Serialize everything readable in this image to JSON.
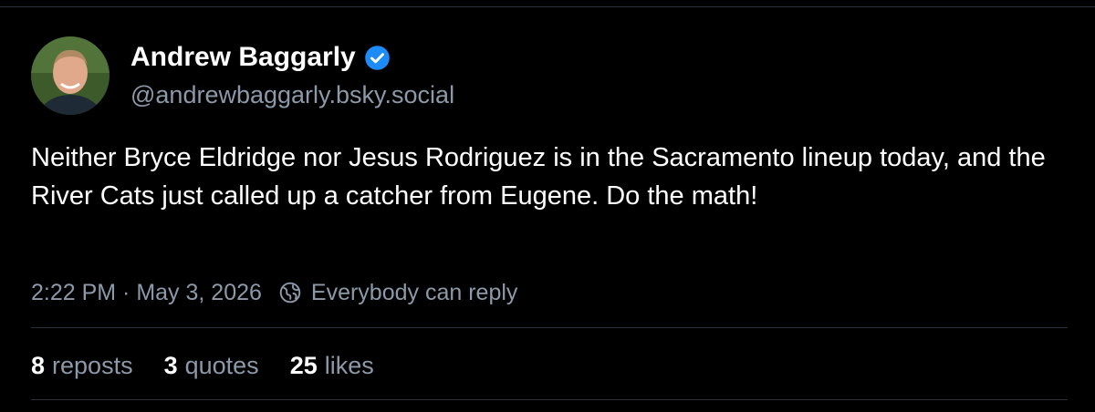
{
  "author": {
    "display_name": "Andrew Baggarly",
    "handle": "@andrewbaggarly.bsky.social",
    "verified": true
  },
  "post": {
    "text": "Neither Bryce Eldridge nor Jesus Rodriguez is in the Sacramento lineup today, and the River Cats just called up a catcher from Eugene. Do the math!",
    "timestamp": "2:22 PM · May 3, 2026",
    "reply_setting": "Everybody can reply"
  },
  "stats": {
    "reposts_count": "8",
    "reposts_label": "reposts",
    "quotes_count": "3",
    "quotes_label": "quotes",
    "likes_count": "25",
    "likes_label": "likes"
  },
  "icons": {
    "verified": "verified-badge-icon",
    "reply_setting": "globe-icon"
  },
  "colors": {
    "background": "#000000",
    "text": "#ffffff",
    "muted": "#8c99a9",
    "verified": "#1d8cf8",
    "divider": "#2a313a"
  }
}
